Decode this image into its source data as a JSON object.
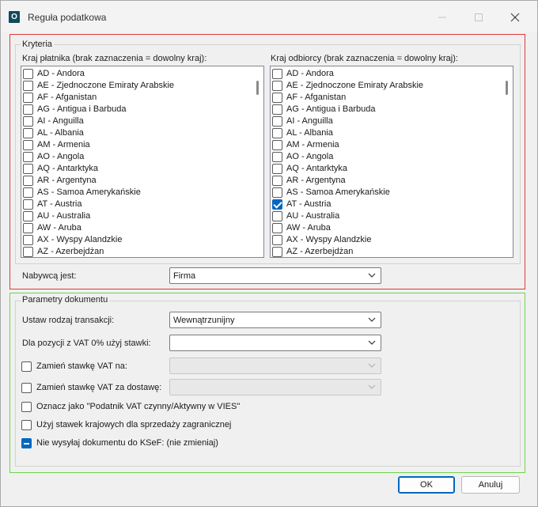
{
  "window": {
    "title": "Reguła podatkowa",
    "app_icon": "O"
  },
  "kryteria": {
    "legend": "Kryteria",
    "payer_label": "Kraj płatnika (brak zaznaczenia = dowolny kraj):",
    "receiver_label": "Kraj odbiorcy (brak zaznaczenia = dowolny kraj):",
    "payer_countries": [
      {
        "label": "AD - Andora",
        "checked": false
      },
      {
        "label": "AE - Zjednoczone Emiraty Arabskie",
        "checked": false
      },
      {
        "label": "AF - Afganistan",
        "checked": false
      },
      {
        "label": "AG - Antigua i Barbuda",
        "checked": false
      },
      {
        "label": "AI - Anguilla",
        "checked": false
      },
      {
        "label": "AL - Albania",
        "checked": false
      },
      {
        "label": "AM - Armenia",
        "checked": false
      },
      {
        "label": "AO - Angola",
        "checked": false
      },
      {
        "label": "AQ - Antarktyka",
        "checked": false
      },
      {
        "label": "AR - Argentyna",
        "checked": false
      },
      {
        "label": "AS - Samoa Amerykańskie",
        "checked": false
      },
      {
        "label": "AT - Austria",
        "checked": false
      },
      {
        "label": "AU - Australia",
        "checked": false
      },
      {
        "label": "AW - Aruba",
        "checked": false
      },
      {
        "label": "AX - Wyspy Alandzkie",
        "checked": false
      },
      {
        "label": "AZ - Azerbejdżan",
        "checked": false
      }
    ],
    "receiver_countries": [
      {
        "label": "AD - Andora",
        "checked": false
      },
      {
        "label": "AE - Zjednoczone Emiraty Arabskie",
        "checked": false
      },
      {
        "label": "AF - Afganistan",
        "checked": false
      },
      {
        "label": "AG - Antigua i Barbuda",
        "checked": false
      },
      {
        "label": "AI - Anguilla",
        "checked": false
      },
      {
        "label": "AL - Albania",
        "checked": false
      },
      {
        "label": "AM - Armenia",
        "checked": false
      },
      {
        "label": "AO - Angola",
        "checked": false
      },
      {
        "label": "AQ - Antarktyka",
        "checked": false
      },
      {
        "label": "AR - Argentyna",
        "checked": false
      },
      {
        "label": "AS - Samoa Amerykańskie",
        "checked": false
      },
      {
        "label": "AT - Austria",
        "checked": true
      },
      {
        "label": "AU - Australia",
        "checked": false
      },
      {
        "label": "AW - Aruba",
        "checked": false
      },
      {
        "label": "AX - Wyspy Alandzkie",
        "checked": false
      },
      {
        "label": "AZ - Azerbejdżan",
        "checked": false
      }
    ],
    "buyer_label": "Nabywcą jest:",
    "buyer_value": "Firma"
  },
  "parametry": {
    "legend": "Parametry dokumentu",
    "transaction_label": "Ustaw rodzaj transakcji:",
    "transaction_value": "Wewnątrzunijny",
    "vat0_label": "Dla pozycji z VAT 0% użyj stawki:",
    "vat0_value": "",
    "replace_vat": {
      "label": "Zamień stawkę VAT na:",
      "checked": false,
      "value": ""
    },
    "replace_vat_delivery": {
      "label": "Zamień stawkę VAT za dostawę:",
      "checked": false,
      "value": ""
    },
    "mark_active": {
      "label": "Oznacz jako \"Podatnik VAT czynny/Aktywny w VIES\"",
      "checked": false
    },
    "use_domestic": {
      "label": "Użyj stawek krajowych dla sprzedaży zagranicznej",
      "checked": false
    },
    "ksef": {
      "label": "Nie wysyłaj dokumentu do KSeF: (nie zmieniaj)",
      "state": "indeterminate"
    }
  },
  "buttons": {
    "ok": "OK",
    "cancel": "Anuluj"
  },
  "colors": {
    "criteria_border": "#e03a3a",
    "params_border": "#6fd64c",
    "accent": "#0067c0"
  }
}
